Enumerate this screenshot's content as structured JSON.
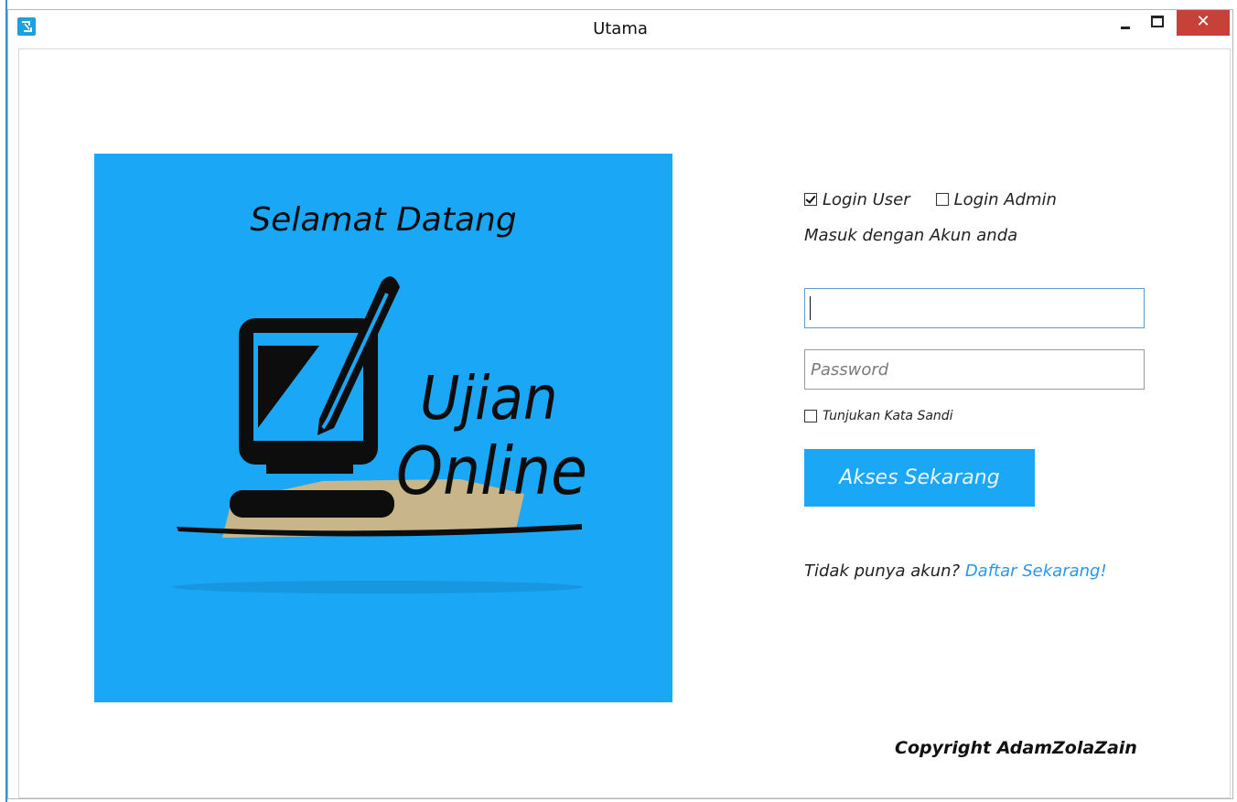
{
  "window": {
    "title": "Utama",
    "close_glyph": "✕",
    "icons": [
      "app-icon",
      "minimize-icon",
      "maximize-icon",
      "close-icon"
    ]
  },
  "hero": {
    "title": "Selamat Datang",
    "logo_word_1": "Ujian",
    "logo_word_2": "Online",
    "background": "#1aa7f6"
  },
  "login": {
    "options": [
      {
        "label": "Login User",
        "checked": true
      },
      {
        "label": "Login Admin",
        "checked": false
      }
    ],
    "subtitle": "Masuk dengan Akun anda",
    "username_value": "",
    "password_placeholder": "Password",
    "show_password_label": "Tunjukan Kata Sandi",
    "submit_label": "Akses Sekarang",
    "register_prompt": "Tidak punya akun?",
    "register_link": "Daftar Sekarang!",
    "accent": "#1aa7f6",
    "link_color": "#2b97e8"
  },
  "footer": {
    "copyright": "Copyright AdamZolaZain"
  }
}
